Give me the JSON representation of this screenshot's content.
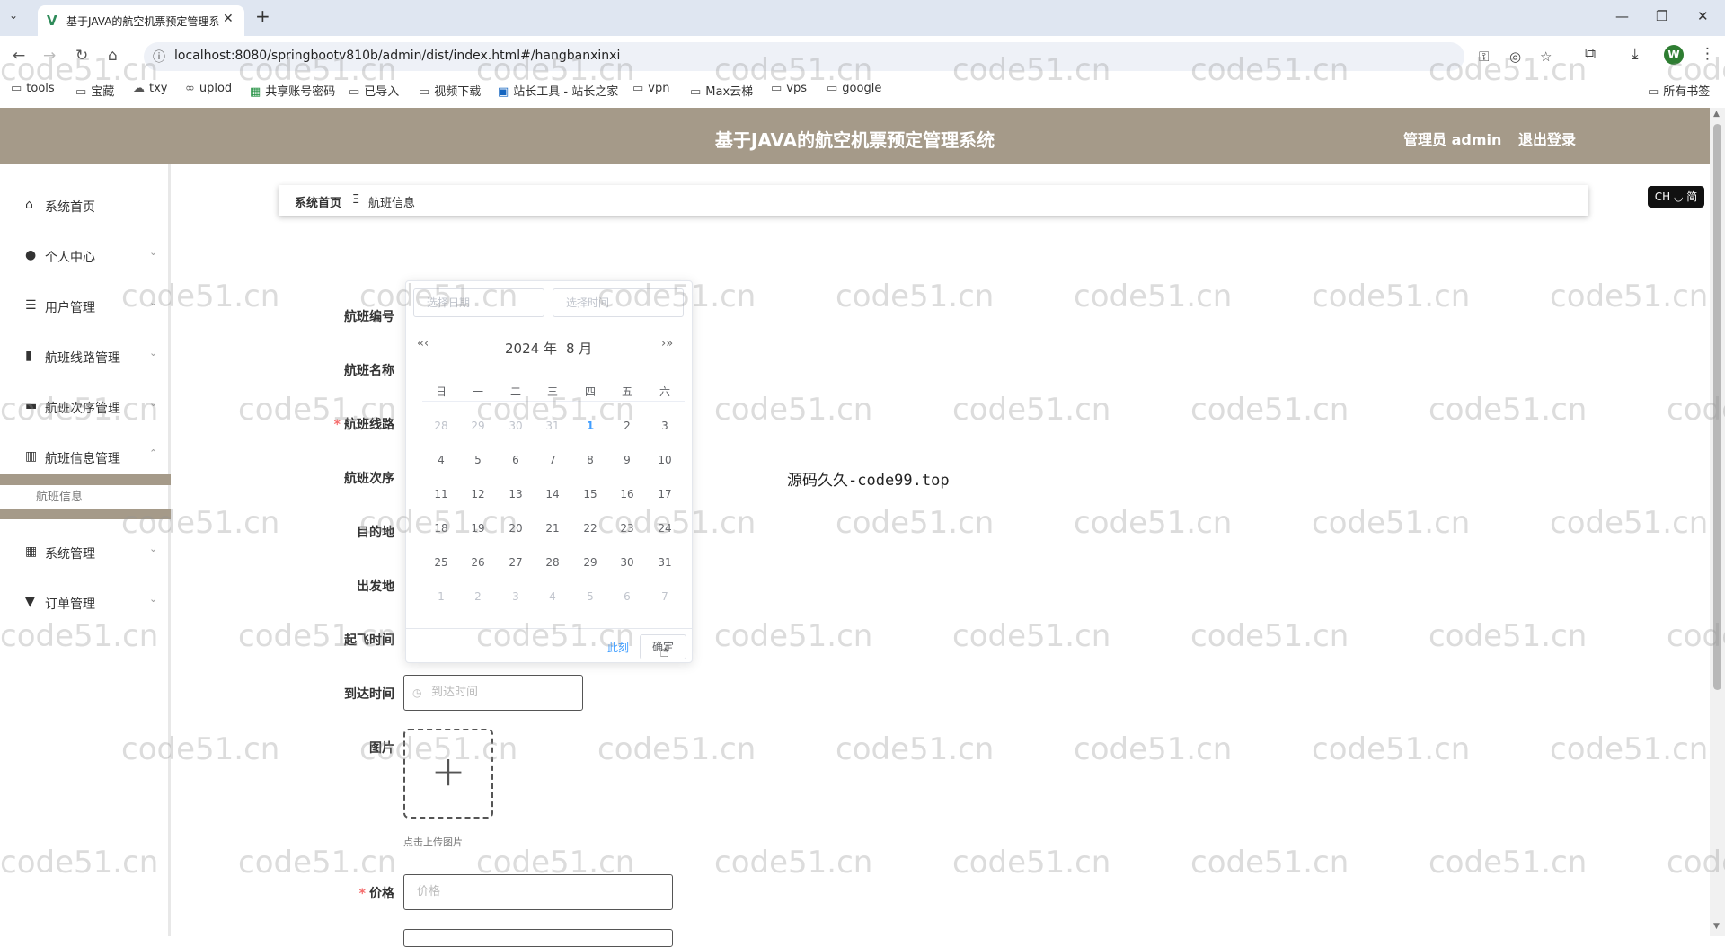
{
  "browser": {
    "tab_title": "基于JAVA的航空机票预定管理系",
    "tab_favicon": "vue-logo-icon",
    "url": "localhost:8080/springbootv810b/admin/dist/index.html#/hangbanxinxi",
    "profile_initial": "W",
    "bookmarks": [
      {
        "label": "tools",
        "icon": "folder-icon"
      },
      {
        "label": "宝藏",
        "icon": "folder-icon"
      },
      {
        "label": "txy",
        "icon": "cloud-icon"
      },
      {
        "label": "uplod",
        "icon": "link-icon"
      },
      {
        "label": "共享账号密码",
        "icon": "sheet-icon"
      },
      {
        "label": "已导入",
        "icon": "folder-icon"
      },
      {
        "label": "视频下载",
        "icon": "folder-icon"
      },
      {
        "label": "站长工具 - 站长之家",
        "icon": "site-icon"
      },
      {
        "label": "vpn",
        "icon": "folder-icon"
      },
      {
        "label": "Max云梯",
        "icon": "folder-icon"
      },
      {
        "label": "vps",
        "icon": "folder-icon"
      },
      {
        "label": "google",
        "icon": "folder-icon"
      }
    ],
    "all_bookmarks": "所有书签"
  },
  "header": {
    "title": "基于JAVA的航空机票预定管理系统",
    "admin": "管理员 admin",
    "logout": "退出登录",
    "bg_color": "#a59a89"
  },
  "sidebar": {
    "items": [
      {
        "label": "系统首页",
        "icon": "home-icon"
      },
      {
        "label": "个人中心",
        "icon": "user-icon"
      },
      {
        "label": "用户管理",
        "icon": "list-icon"
      },
      {
        "label": "航班线路管理",
        "icon": "book-icon"
      },
      {
        "label": "航班次序管理",
        "icon": "briefcase-icon"
      },
      {
        "label": "航班信息管理",
        "icon": "bar-chart-icon"
      },
      {
        "label": "系统管理",
        "icon": "grid-icon"
      },
      {
        "label": "订单管理",
        "icon": "pin-icon"
      }
    ],
    "sub_item": "航班信息"
  },
  "breadcrumb": {
    "home": "系统首页",
    "separator": "Ξ",
    "current": "航班信息"
  },
  "lang_badge": "CH ◡ 简",
  "form": {
    "labels": {
      "flight_no": "航班编号",
      "flight_name": "航班名称",
      "route": "航班线路",
      "sequence": "航班次序",
      "destination": "目的地",
      "departure": "出发地",
      "takeoff_time": "起飞时间",
      "arrival_time": "到达时间",
      "image": "图片",
      "price": "价格"
    },
    "required_mark": "*",
    "arrival_placeholder": "到达时间",
    "price_placeholder": "价格",
    "upload_hint": "点击上传图片"
  },
  "datepicker": {
    "date_placeholder": "选择日期",
    "time_placeholder": "选择时间",
    "year": "2024 年",
    "month": "8 月",
    "weekdays": [
      "日",
      "一",
      "二",
      "三",
      "四",
      "五",
      "六"
    ],
    "rows": [
      [
        "28",
        "29",
        "30",
        "31",
        "1",
        "2",
        "3"
      ],
      [
        "4",
        "5",
        "6",
        "7",
        "8",
        "9",
        "10"
      ],
      [
        "11",
        "12",
        "13",
        "14",
        "15",
        "16",
        "17"
      ],
      [
        "18",
        "19",
        "20",
        "21",
        "22",
        "23",
        "24"
      ],
      [
        "25",
        "26",
        "27",
        "28",
        "29",
        "30",
        "31"
      ],
      [
        "1",
        "2",
        "3",
        "4",
        "5",
        "6",
        "7"
      ]
    ],
    "today": "1",
    "now_label": "此刻",
    "ok_label": "确定"
  },
  "center_text": "源码久久-code99.top",
  "watermark": "code51.cn"
}
